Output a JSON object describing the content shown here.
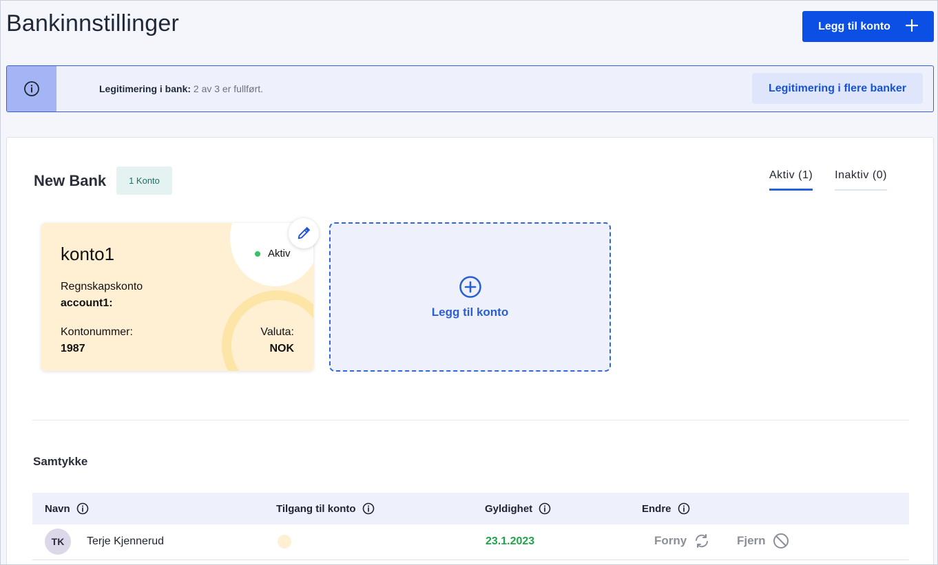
{
  "header": {
    "title": "Bankinnstillinger",
    "add_account_label": "Legg til konto"
  },
  "banner": {
    "label_bold": "Legitimering i bank:",
    "label_text": "2 av 3 er fullført.",
    "button_label": "Legitimering i flere banker"
  },
  "bank": {
    "name": "New Bank",
    "badge": "1 Konto",
    "tabs": [
      {
        "label": "Aktiv (1)",
        "active": true
      },
      {
        "label": "Inaktiv (0)",
        "active": false
      }
    ]
  },
  "account": {
    "name": "konto1",
    "status": "Aktiv",
    "ledger_label": "Regnskapskonto",
    "ledger_value": "account1:",
    "number_label": "Kontonummer:",
    "number_value": "1987",
    "currency_label": "Valuta:",
    "currency_value": "NOK"
  },
  "add_card": {
    "label": "Legg til konto"
  },
  "consent": {
    "title": "Samtykke",
    "columns": [
      "Navn",
      "Tilgang til konto",
      "Gyldighet",
      "Endre"
    ],
    "rows": [
      {
        "initials": "TK",
        "name": "Terje Kjennerud",
        "validity": "23.1.2023",
        "renew_label": "Forny",
        "remove_label": "Fjern"
      }
    ]
  },
  "colors": {
    "primary": "#0b4fe5",
    "card_bg": "#fff0d4",
    "active_dot": "#34c263",
    "validity_green": "#1ea54a"
  }
}
